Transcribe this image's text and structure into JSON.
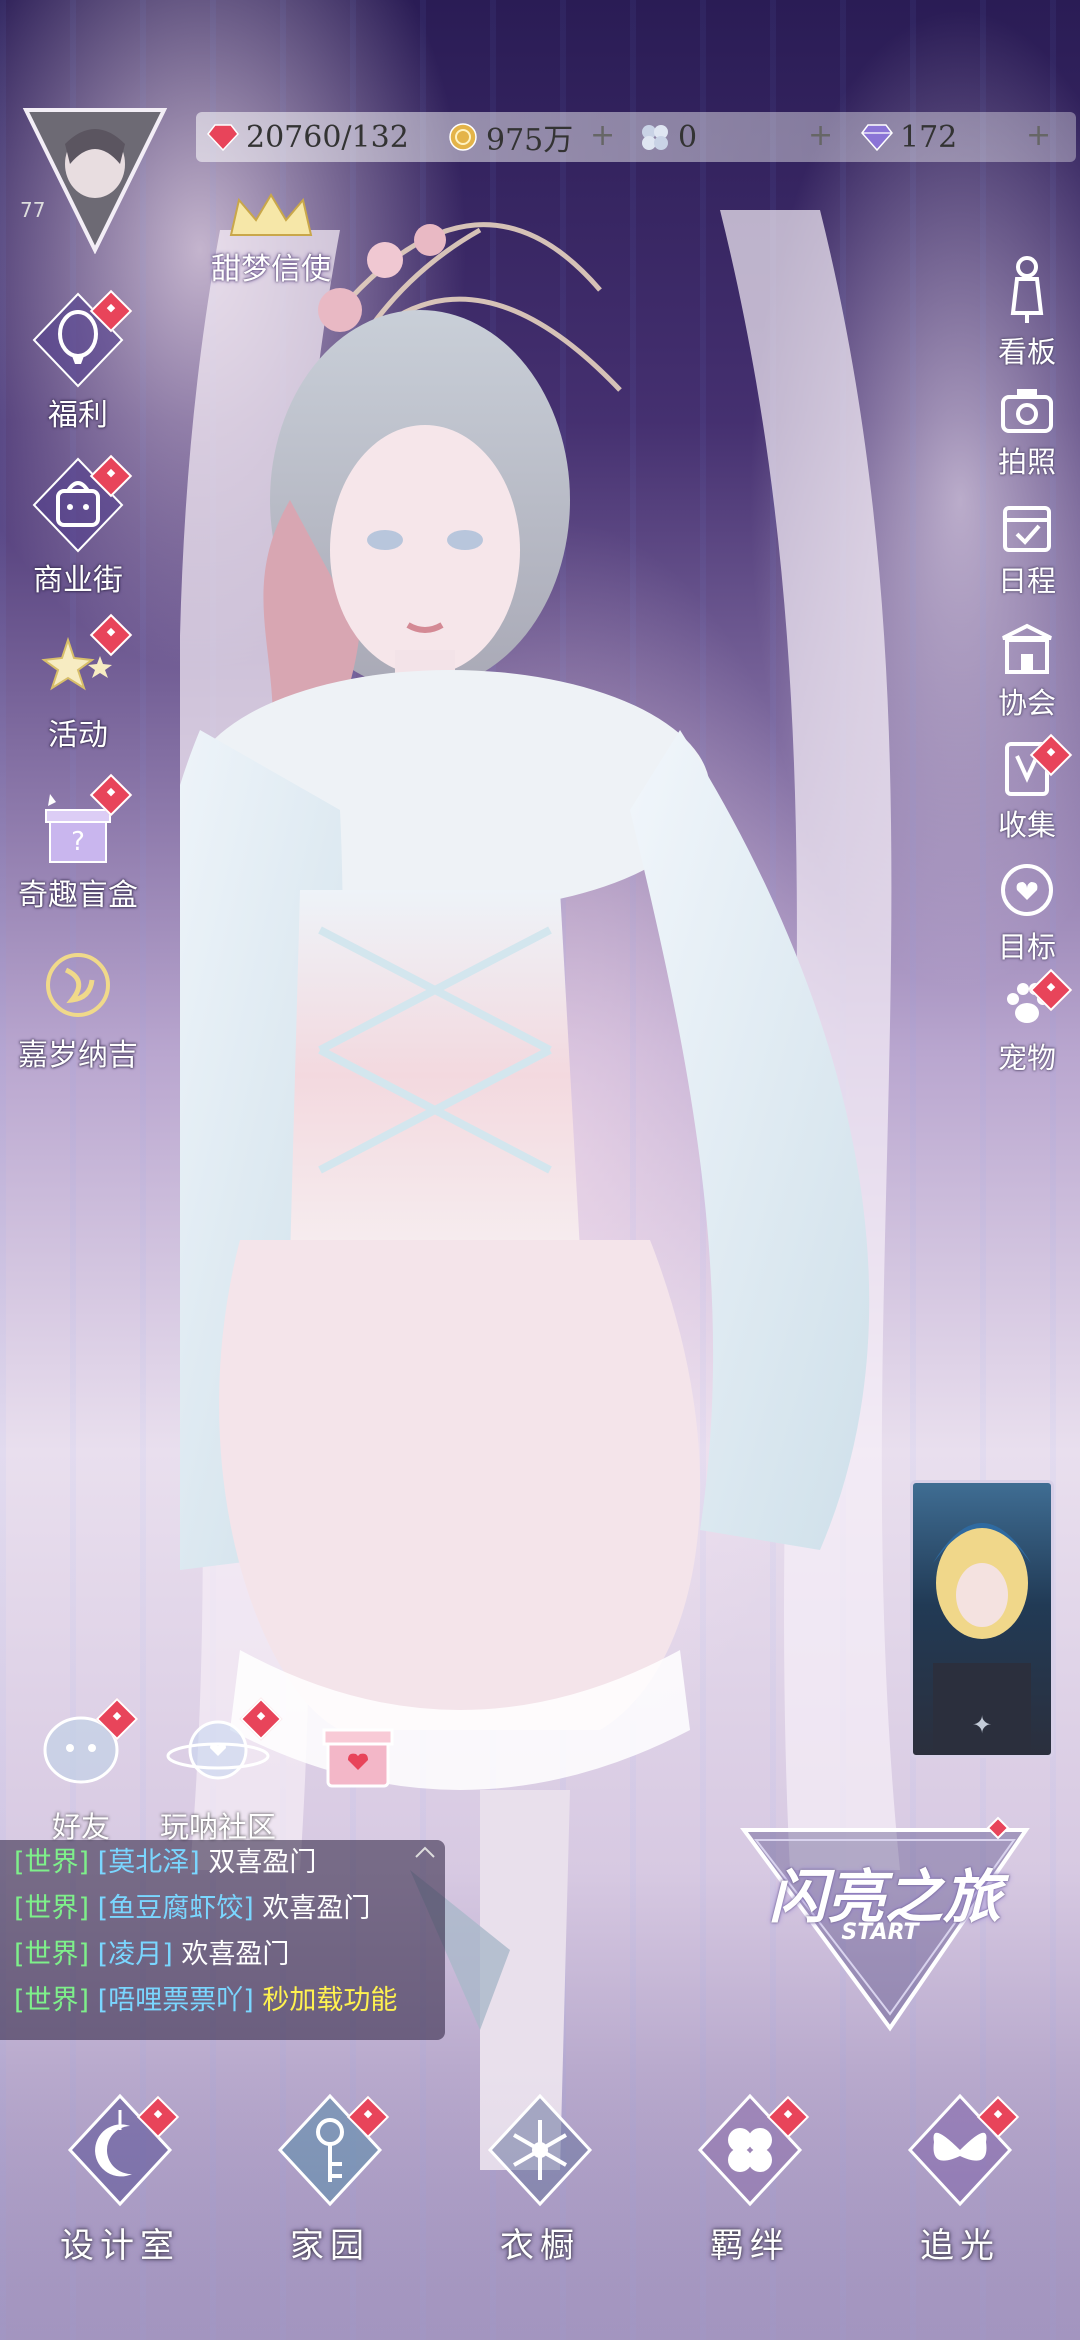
{
  "resources": {
    "stamina": "20760/132",
    "coins": "975万",
    "diamonds": "0",
    "crystals": "172"
  },
  "profile": {
    "level": "77",
    "title": "甜梦信使"
  },
  "left_menu": [
    {
      "label": "福利"
    },
    {
      "label": "商业街"
    },
    {
      "label": "活动"
    },
    {
      "label": "奇趣盲盒"
    },
    {
      "label": "嘉岁纳吉"
    }
  ],
  "right_menu": [
    {
      "label": "看板"
    },
    {
      "label": "拍照"
    },
    {
      "label": "日程"
    },
    {
      "label": "协会"
    },
    {
      "label": "收集"
    },
    {
      "label": "目标"
    },
    {
      "label": "宠物"
    }
  ],
  "social": {
    "friends": "好友",
    "community": "玩呐社区"
  },
  "chat": [
    {
      "channel": "[世界]",
      "name": "[莫北泽]",
      "message": "双喜盈门",
      "highlight": false
    },
    {
      "channel": "[世界]",
      "name": "[鱼豆腐虾饺]",
      "message": "欢喜盈门",
      "highlight": false
    },
    {
      "channel": "[世界]",
      "name": "[凌月]",
      "message": "欢喜盈门",
      "highlight": false
    },
    {
      "channel": "[世界]",
      "name": "[唔哩票票吖]",
      "message": "秒加载功能",
      "highlight": true
    }
  ],
  "event": {
    "title": "闪亮之旅",
    "subtitle": "START"
  },
  "bottom_nav": [
    {
      "label": "设计室"
    },
    {
      "label": "家园"
    },
    {
      "label": "衣橱"
    },
    {
      "label": "羁绊"
    },
    {
      "label": "追光"
    }
  ],
  "colors": {
    "badge_red": "#e8445a",
    "chat_channel": "#7ef08a",
    "chat_name": "#7ad6ff",
    "chat_highlight": "#fff24f"
  }
}
